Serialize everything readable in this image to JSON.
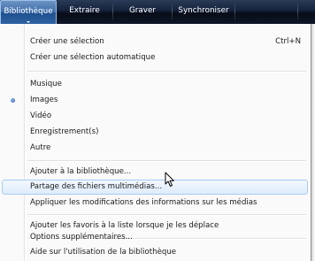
{
  "tabs": [
    {
      "label": "Bibliothèque",
      "active": true
    },
    {
      "label": "Extraire",
      "active": false
    },
    {
      "label": "Graver",
      "active": false
    },
    {
      "label": "Synchroniser",
      "active": false
    }
  ],
  "menu": {
    "create_playlist": {
      "label": "Créer une sélection",
      "shortcut": "Ctrl+N"
    },
    "create_auto_playlist": {
      "label": "Créer une sélection automatique"
    },
    "music": {
      "label": "Musique"
    },
    "images": {
      "label": "Images",
      "selected": true
    },
    "video": {
      "label": "Vidéo"
    },
    "recordings": {
      "label": "Enregistrement(s)"
    },
    "other": {
      "label": "Autre"
    },
    "add_to_library": {
      "label": "Ajouter à la bibliothèque..."
    },
    "media_sharing": {
      "label": "Partage des fichiers multimédias...",
      "hovered": true
    },
    "apply_media_info": {
      "label": "Appliquer les modifications des informations sur les médias"
    },
    "add_favorites": {
      "label": "Ajouter les favoris à la liste lorsque je les déplace"
    },
    "more_options": {
      "label": "Options supplémentaires..."
    },
    "library_help": {
      "label": "Aide sur l'utilisation de la bibliothèque"
    }
  },
  "colors": {
    "toolbar_dark": "#070c17",
    "active_tab": "#3f6faa",
    "hover_border": "#a8cbf0",
    "hover_fill": "#dfecfb",
    "radio_bullet": "#1e5bb8"
  },
  "icons": {
    "selected_bullet": "radio-bullet-icon",
    "pointer": "mouse-pointer-icon",
    "tab_dropdown": "chevron-down-icon"
  }
}
